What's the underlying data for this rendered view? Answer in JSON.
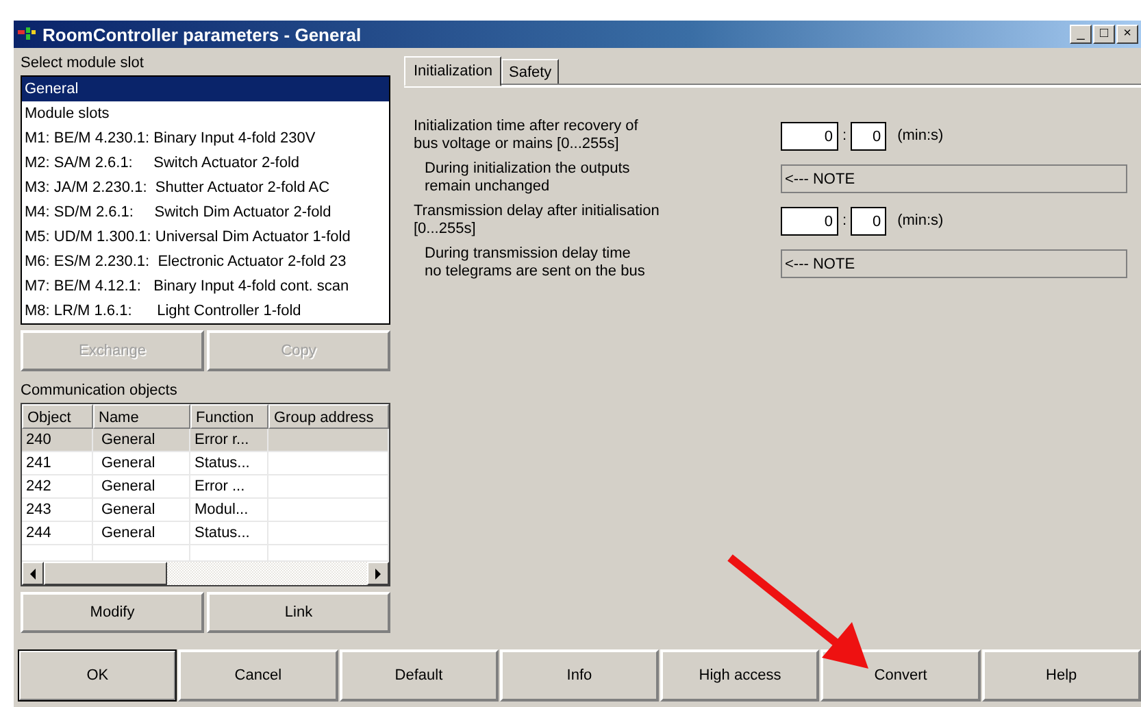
{
  "window": {
    "title": "RoomController parameters - General",
    "controls": [
      "_",
      "□",
      "×"
    ]
  },
  "module_slot": {
    "label": "Select module slot",
    "items": [
      {
        "text": "General",
        "selected": true
      },
      {
        "text": "Module slots",
        "selected": false
      },
      {
        "text": "M1: BE/M 4.230.1: Binary Input 4-fold 230V",
        "selected": false
      },
      {
        "text": "M2: SA/M 2.6.1:     Switch Actuator 2-fold",
        "selected": false
      },
      {
        "text": "M3: JA/M 2.230.1:  Shutter Actuator 2-fold AC",
        "selected": false
      },
      {
        "text": "M4: SD/M 2.6.1:     Switch Dim Actuator 2-fold",
        "selected": false
      },
      {
        "text": "M5: UD/M 1.300.1: Universal Dim Actuator 1-fold",
        "selected": false
      },
      {
        "text": "M6: ES/M 2.230.1:  Electronic Actuator 2-fold 23",
        "selected": false
      },
      {
        "text": "M7: BE/M 4.12.1:   Binary Input 4-fold cont. scan",
        "selected": false
      },
      {
        "text": "M8: LR/M 1.6.1:      Light Controller 1-fold",
        "selected": false
      }
    ],
    "buttons": [
      {
        "label": "Exchange",
        "disabled": true
      },
      {
        "label": "Copy",
        "disabled": true
      }
    ]
  },
  "communication_objects": {
    "label": "Communication objects",
    "columns": [
      "Object",
      "Name",
      "Function",
      "Group address"
    ],
    "rows": [
      {
        "cells": [
          "240",
          "General",
          "Error r..."
        ],
        "selected": true
      },
      {
        "cells": [
          "241",
          "General",
          "Status..."
        ],
        "selected": false
      },
      {
        "cells": [
          "242",
          "General",
          "Error ..."
        ],
        "selected": false
      },
      {
        "cells": [
          "243",
          "General",
          "Modul..."
        ],
        "selected": false
      },
      {
        "cells": [
          "244",
          "General",
          "Status..."
        ],
        "selected": false
      }
    ],
    "buttons": [
      {
        "label": "Modify",
        "disabled": false
      },
      {
        "label": "Link",
        "disabled": false
      }
    ]
  },
  "tabs": [
    {
      "label": "Initialization",
      "selected": true
    },
    {
      "label": "Safety",
      "selected": false
    }
  ],
  "parameters": [
    {
      "kind": "time",
      "label_lines": [
        "Initialization time after recovery of",
        "bus voltage or mains [0...255s]"
      ],
      "minutes": "0",
      "separator": ":",
      "seconds": "0",
      "unit": "(min:s)"
    },
    {
      "kind": "note",
      "label_lines": [
        "During initialization the outputs",
        "remain unchanged"
      ],
      "value": "<--- NOTE"
    },
    {
      "kind": "time",
      "label_lines": [
        "Transmission delay after initialisation",
        "[0...255s]"
      ],
      "minutes": "0",
      "separator": ":",
      "seconds": "0",
      "unit": "(min:s)"
    },
    {
      "kind": "note",
      "label_lines": [
        "During transmission delay time",
        "no telegrams are sent on the bus"
      ],
      "value": "<--- NOTE"
    }
  ],
  "footer_buttons": [
    {
      "label": "OK",
      "default": true
    },
    {
      "label": "Cancel",
      "default": false
    },
    {
      "label": "Default",
      "default": false
    },
    {
      "label": "Info",
      "default": false
    },
    {
      "label": "High access",
      "default": false
    },
    {
      "label": "Convert",
      "default": false
    },
    {
      "label": "Help",
      "default": false
    }
  ]
}
